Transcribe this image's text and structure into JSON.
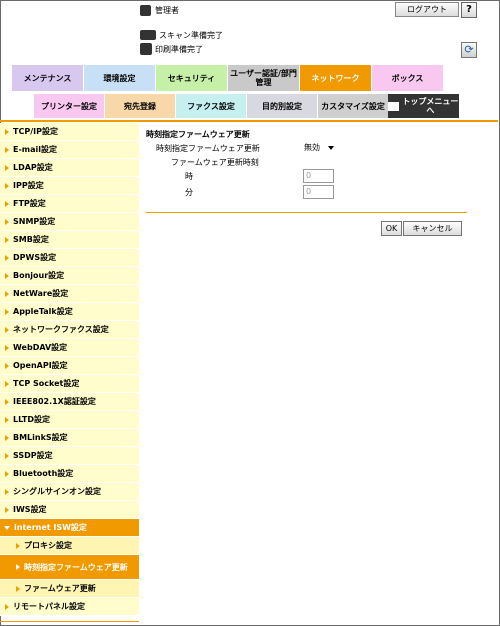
{
  "header": {
    "user": "管理者",
    "logout": "ログアウト",
    "help": "?",
    "refresh": "⟳"
  },
  "status": {
    "scan": "スキャン準備完了",
    "print": "印刷準備完了"
  },
  "tabs1": [
    {
      "label": "メンテナンス",
      "color": "#d8c8f0"
    },
    {
      "label": "環境設定",
      "color": "#c8e0f5"
    },
    {
      "label": "セキュリティ",
      "color": "#c6f0a8"
    },
    {
      "label": "ユーザー認証/部門管理",
      "color": "#c9c9c9"
    },
    {
      "label": "ネットワーク",
      "color": "#f09a00"
    },
    {
      "label": "ボックス",
      "color": "#f8c8f0"
    }
  ],
  "tabs2": [
    {
      "label": "プリンター設定",
      "color": "#f8c8f0"
    },
    {
      "label": "宛先登録",
      "color": "#f8d8a8"
    },
    {
      "label": "ファクス設定",
      "color": "#c6f0f0"
    },
    {
      "label": "目的別設定",
      "color": "#d8d8e0"
    },
    {
      "label": "カスタマイズ設定",
      "color": "#cfcfcf"
    }
  ],
  "topmenu": "トップメニューへ",
  "sidebar": {
    "items": [
      "TCP/IP設定",
      "E-mail設定",
      "LDAP設定",
      "IPP設定",
      "FTP設定",
      "SNMP設定",
      "SMB設定",
      "DPWS設定",
      "Bonjour設定",
      "NetWare設定",
      "AppleTalk設定",
      "ネットワークファクス設定",
      "WebDAV設定",
      "OpenAPI設定",
      "TCP Socket設定",
      "IEEE802.1X認証設定",
      "LLTD設定",
      "BMLinkS設定",
      "SSDP設定",
      "Bluetooth設定",
      "シングルサインオン設定",
      "IWS設定"
    ],
    "open": "internet ISW設定",
    "sub": [
      "プロキシ設定",
      "時刻指定ファームウェア更新",
      "ファームウェア更新"
    ],
    "last": "リモートパネル設定"
  },
  "content": {
    "title": "時刻指定ファームウェア更新",
    "row1_label": "時刻指定ファームウェア更新",
    "row1_value": "無効",
    "row2_label": "ファームウェア更新時刻",
    "hour_label": "時",
    "hour_value": "0",
    "min_label": "分",
    "min_value": "0",
    "ok": "OK",
    "cancel": "キャンセル"
  }
}
